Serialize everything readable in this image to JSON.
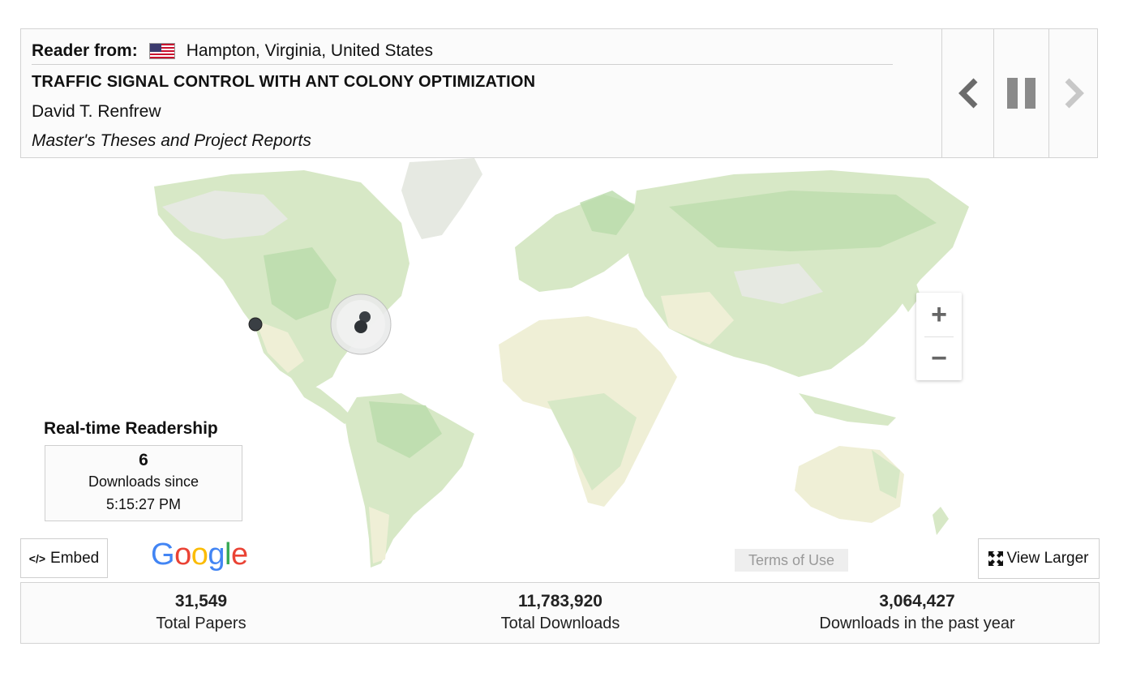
{
  "reader": {
    "from_label": "Reader from:",
    "location": "Hampton, Virginia, United States",
    "flag_icon": "us-flag-icon"
  },
  "paper": {
    "title": "TRAFFIC SIGNAL CONTROL WITH ANT COLONY OPTIMIZATION",
    "author": "David T. Renfrew",
    "collection": "Master's Theses and Project Reports"
  },
  "navigation": {
    "prev_icon": "chevron-left-icon",
    "pause_icon": "pause-icon",
    "next_icon": "chevron-right-icon"
  },
  "map": {
    "zoom_in_label": "+",
    "zoom_out_label": "−"
  },
  "realtime": {
    "title": "Real-time Readership",
    "count": "6",
    "label": "Downloads since",
    "time": "5:15:27 PM"
  },
  "footer": {
    "embed_code_glyph": "</>",
    "embed_label": "Embed",
    "google_letters": [
      "G",
      "o",
      "o",
      "g",
      "l",
      "e"
    ],
    "terms_label": "Terms of Use",
    "view_larger_label": "View Larger"
  },
  "stats": {
    "papers_value": "31,549",
    "papers_label": "Total Papers",
    "downloads_value": "11,783,920",
    "downloads_label": "Total Downloads",
    "year_value": "3,064,427",
    "year_label": "Downloads in the past year"
  },
  "colors": {
    "land_green": "#d7e8c6",
    "land_dark_green": "#b9dbaa",
    "land_sand": "#efefd6",
    "land_grey": "#e6e9e2",
    "google_blue": "#4285f4",
    "google_red": "#ea4335",
    "google_yellow": "#fbbc05",
    "google_green": "#34a853"
  }
}
